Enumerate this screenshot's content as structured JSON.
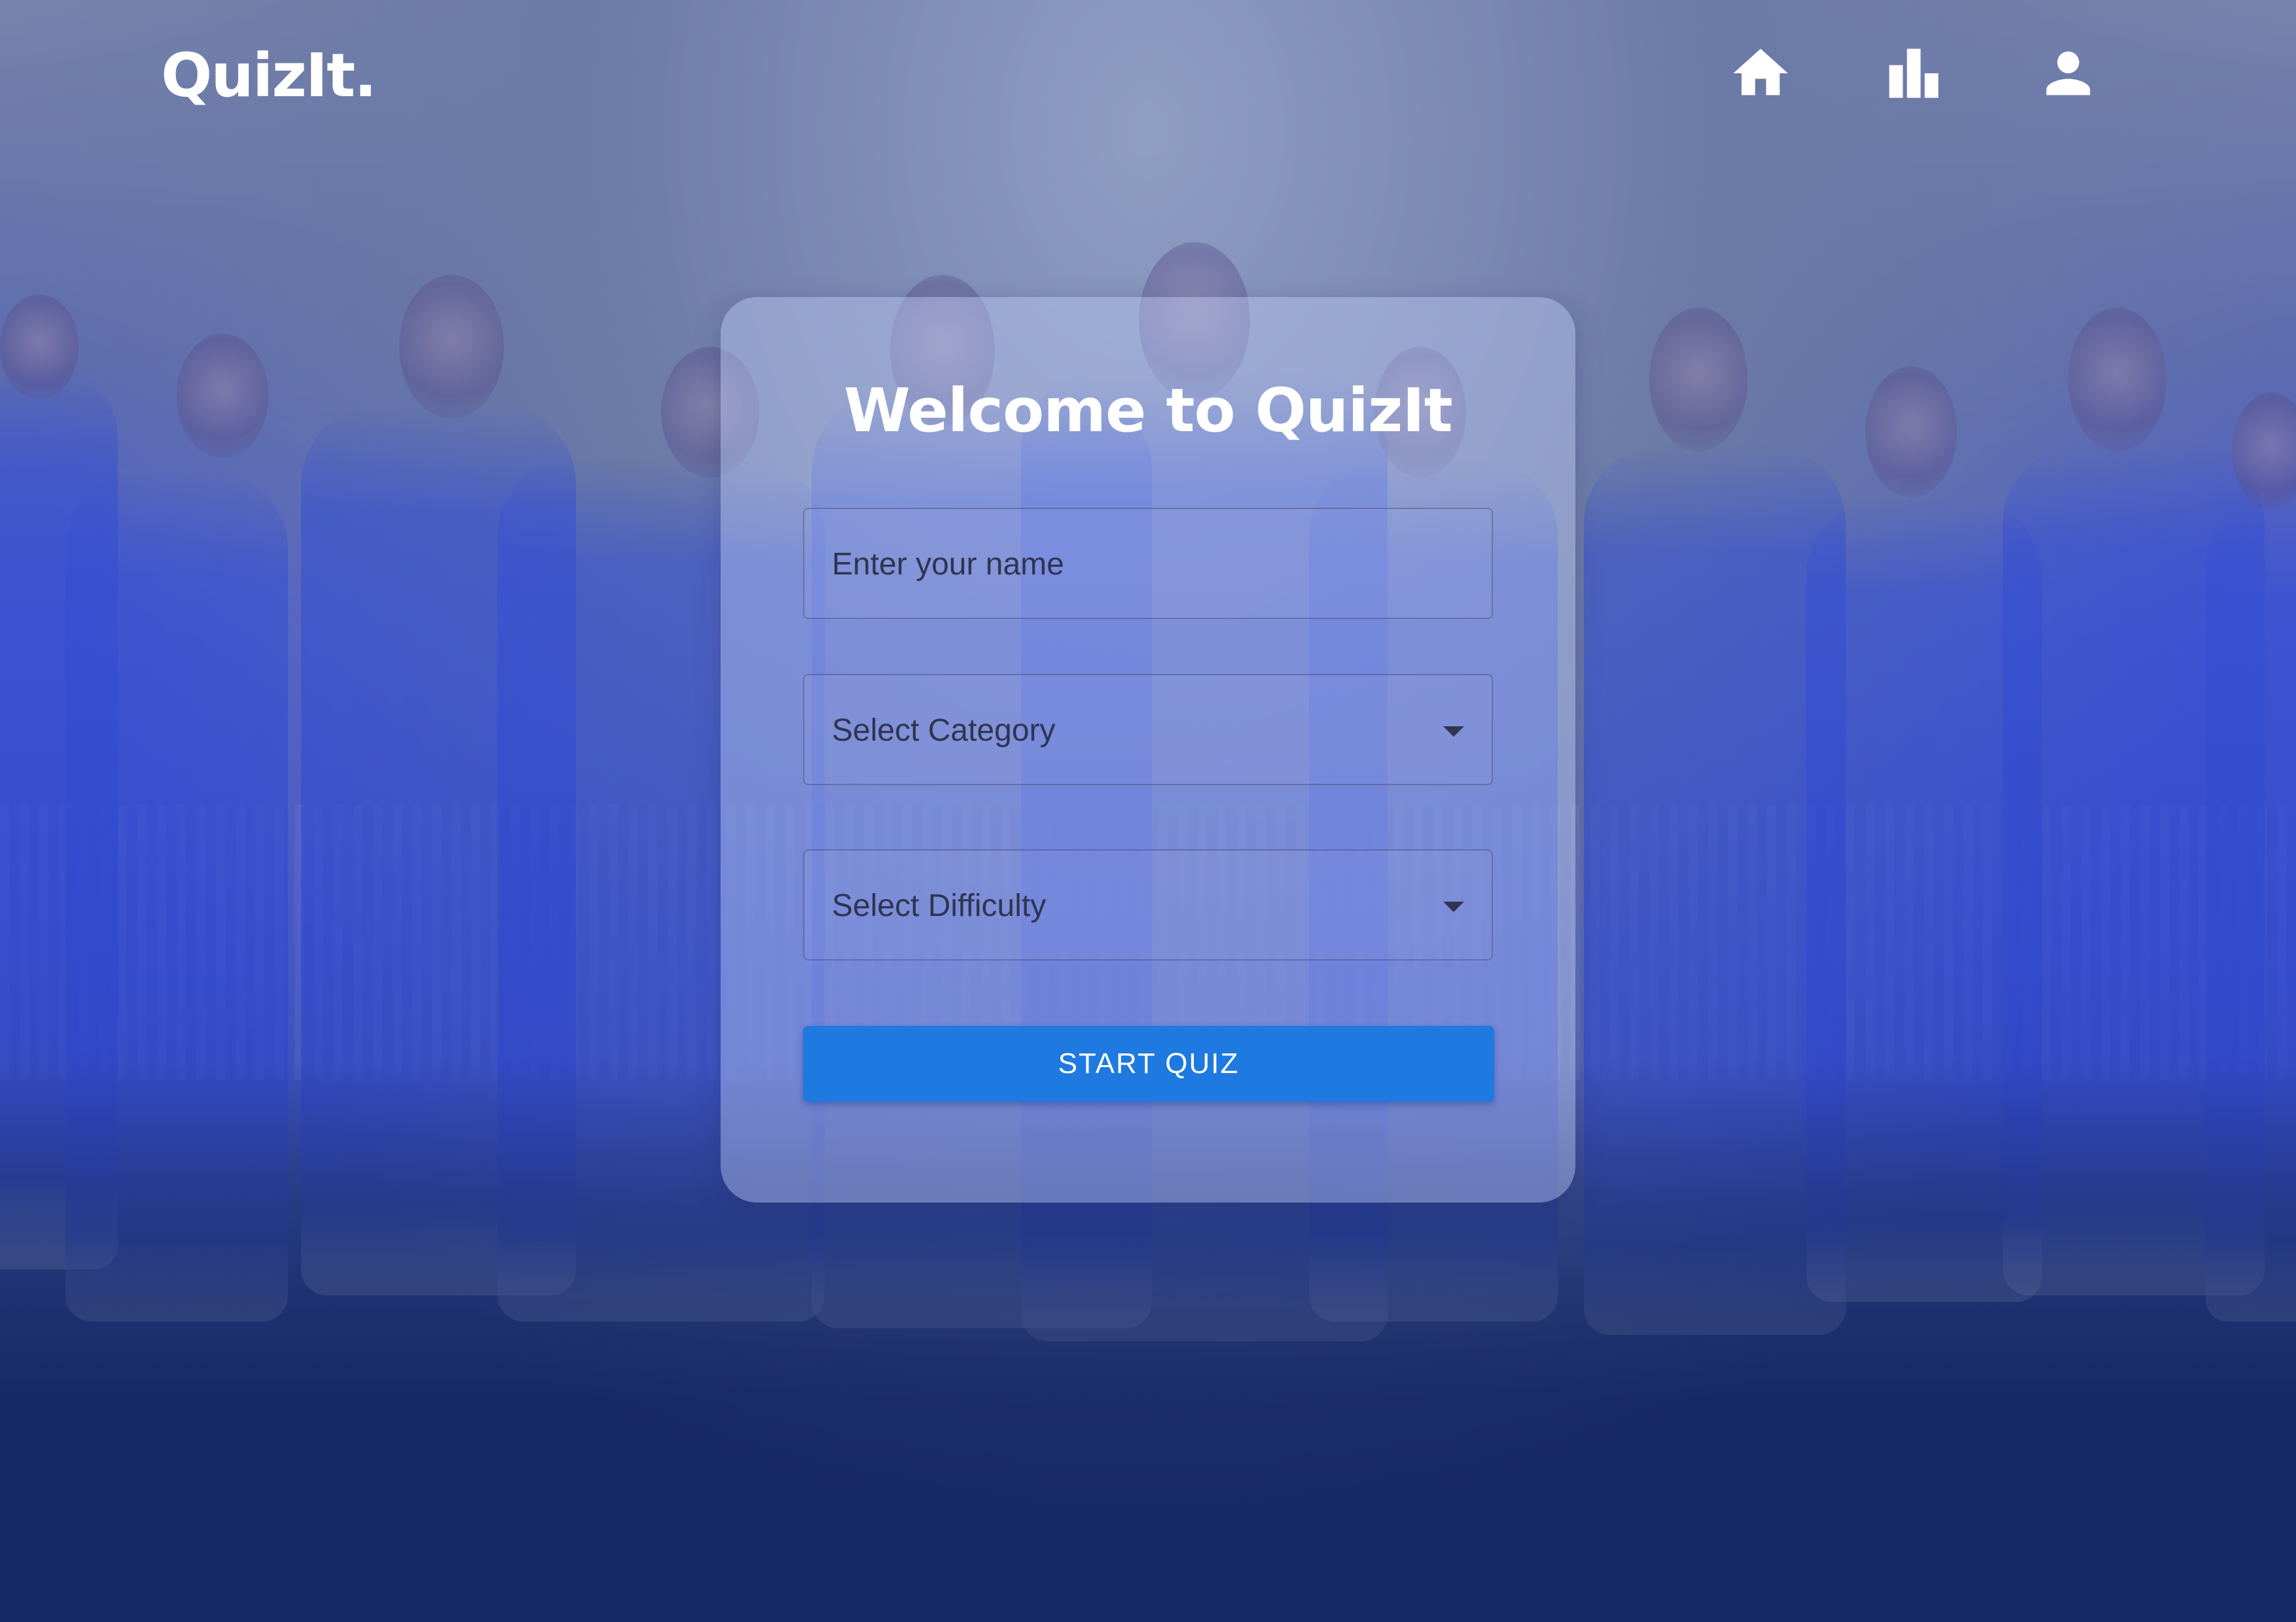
{
  "header": {
    "logo": "QuizIt.",
    "nav": [
      {
        "icon": "home-icon"
      },
      {
        "icon": "leaderboard-icon"
      },
      {
        "icon": "user-icon"
      }
    ]
  },
  "card": {
    "title": "Welcome to QuizIt",
    "name_placeholder": "Enter your name",
    "category_label": "Select Category",
    "difficulty_label": "Select Difficulty",
    "start_label": "START QUIZ"
  },
  "colors": {
    "primary_button": "#1e7ae0",
    "text_on_dark": "#ffffff",
    "field_text": "#2f3552"
  }
}
